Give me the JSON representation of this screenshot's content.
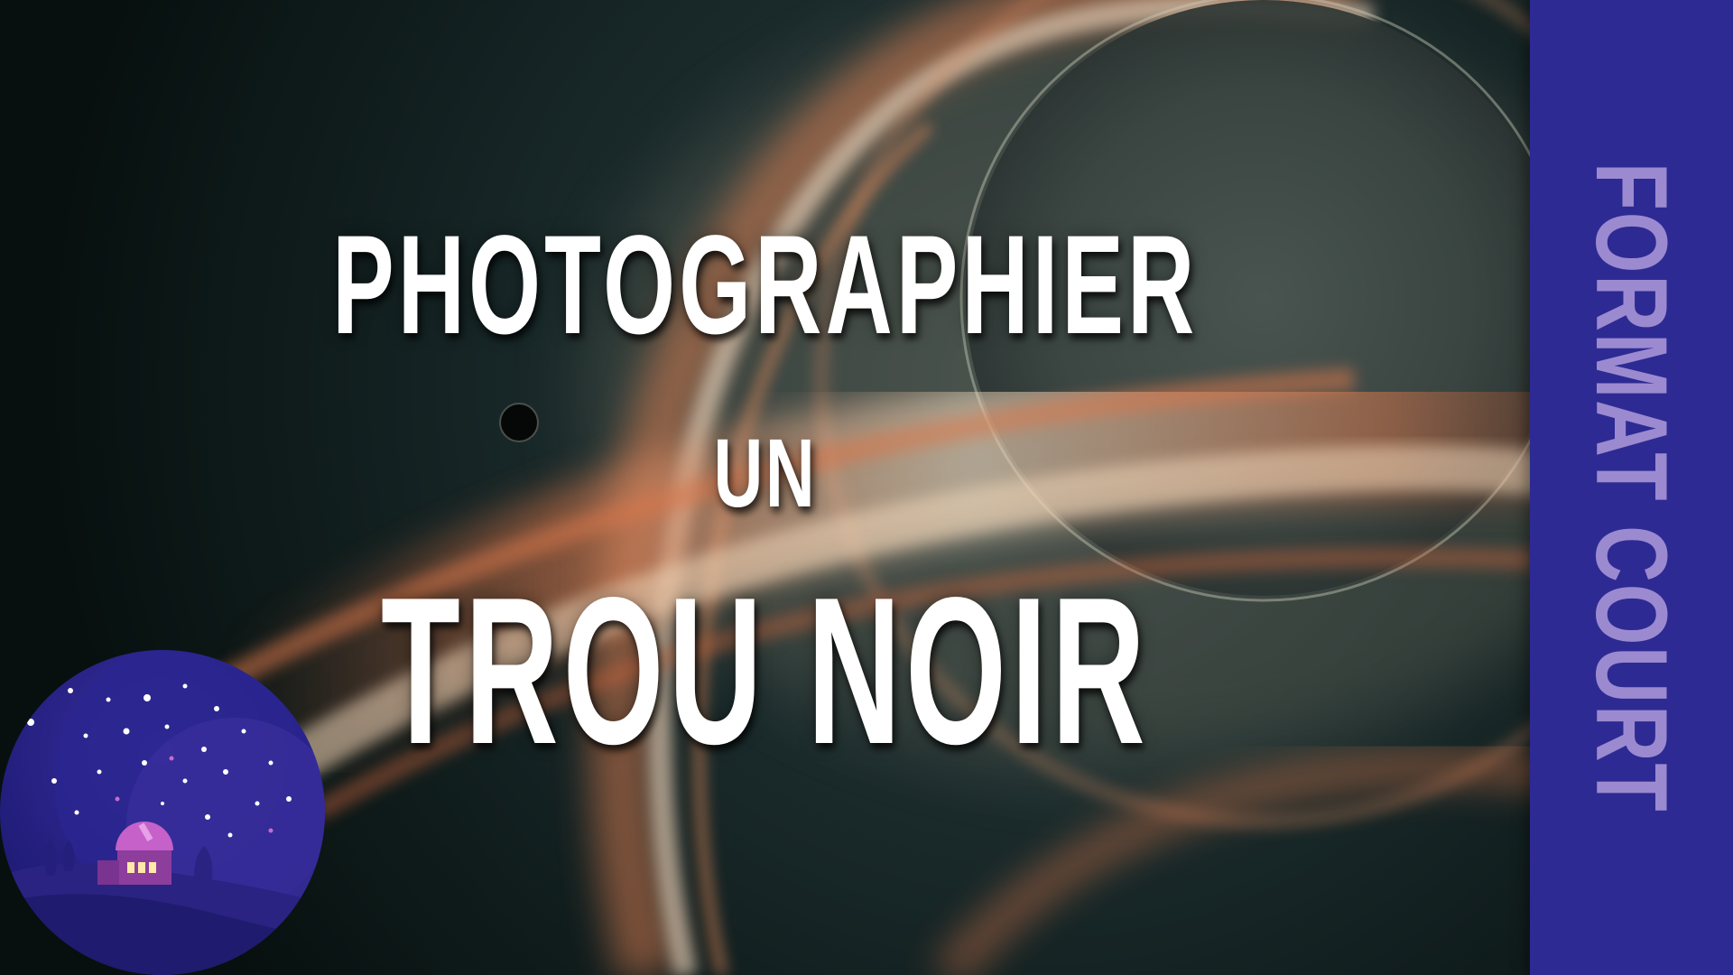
{
  "title": {
    "line1": "PHOTOGRAPHIER",
    "line2": "UN",
    "line3": "TROU NOIR"
  },
  "side_banner": {
    "text": "FORMAT COURT",
    "background": "#2e2a93",
    "text_color": "#9b8ad0"
  },
  "logo": {
    "icon": "observatory-night-sky-logo"
  },
  "colors": {
    "space": "#0b1517",
    "accretion_orange": "#d9774b",
    "accretion_glow": "#e9d2b5"
  }
}
